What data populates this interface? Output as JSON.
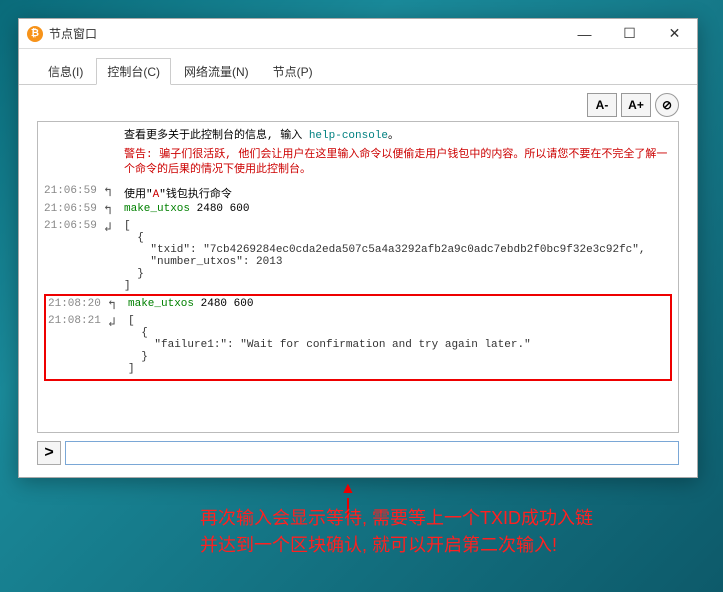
{
  "window": {
    "title": "节点窗口"
  },
  "tabs": {
    "info": "信息(I)",
    "console": "控制台(C)",
    "network": "网络流量(N)",
    "nodes": "节点(P)"
  },
  "toolbar": {
    "font_smaller": "A-",
    "font_larger": "A+",
    "clear": "⊘"
  },
  "intro": {
    "prefix": "查看更多关于此控制台的信息, 输入 ",
    "link": "help-console",
    "suffix": "。"
  },
  "warning": "警告: 骗子们很活跃, 他们会让用户在这里输入命令以便偷走用户钱包中的内容。所以请您不要在不完全了解一个命令的后果的情况下使用此控制台。",
  "log": [
    {
      "ts": "21:06:59",
      "dir": "in",
      "type": "exec",
      "prefix": "使用\"",
      "mid": "A",
      "suffix": "\"钱包执行命令"
    },
    {
      "ts": "21:06:59",
      "dir": "in",
      "type": "cmd",
      "cmd": "make_utxos",
      "args": " 2480 600"
    },
    {
      "ts": "21:06:59",
      "dir": "out",
      "type": "resp",
      "text": "[\n  {\n    \"txid\": \"7cb4269284ec0cda2eda507c5a4a3292afb2a9c0adc7ebdb2f0bc9f32e3c92fc\",\n    \"number_utxos\": 2013\n  }\n]"
    }
  ],
  "log_box": [
    {
      "ts": "21:08:20",
      "dir": "in",
      "type": "cmd",
      "cmd": "make_utxos",
      "args": " 2480 600"
    },
    {
      "ts": "21:08:21",
      "dir": "out",
      "type": "resp",
      "text": "[\n  {\n    \"failure1:\": \"Wait for confirmation and try again later.\"\n  }\n]"
    }
  ],
  "input": {
    "prompt": ">",
    "value": ""
  },
  "caption": {
    "line1": "再次输入会显示等待, 需要等上一个TXID成功入链",
    "line2": "并达到一个区块确认, 就可以开启第二次输入!"
  }
}
